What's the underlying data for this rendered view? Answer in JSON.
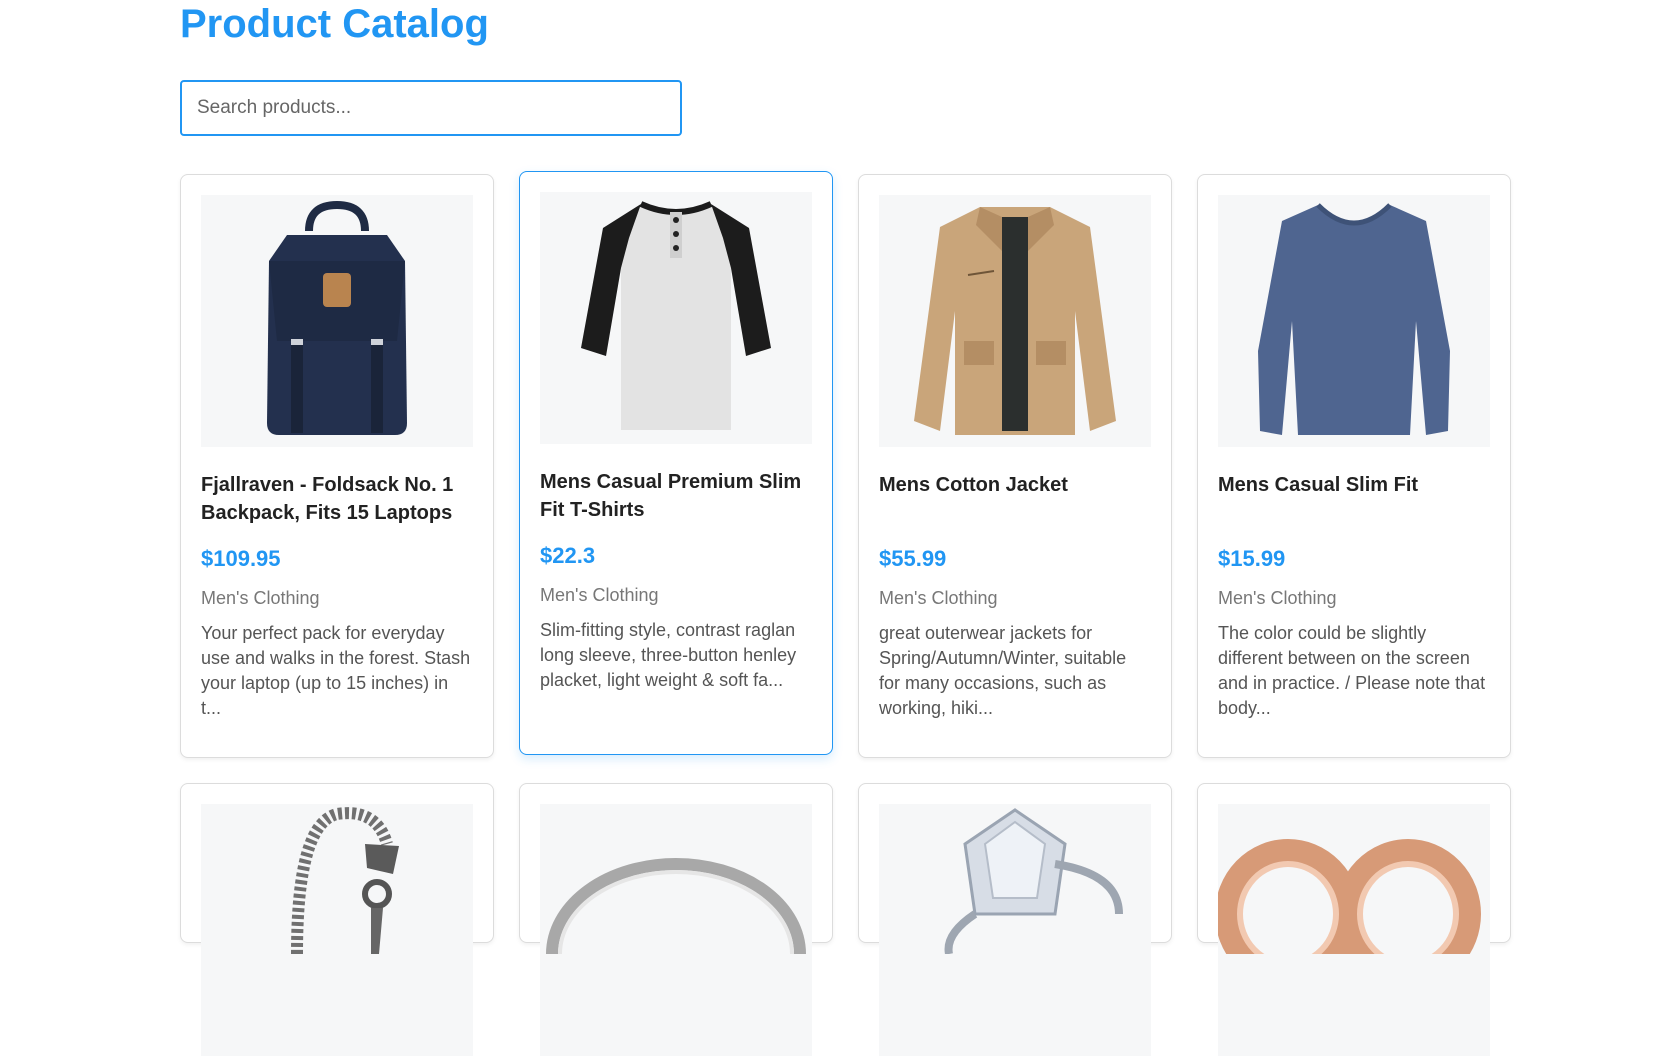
{
  "header": {
    "title": "Product Catalog"
  },
  "search": {
    "placeholder": "Search products..."
  },
  "products": [
    {
      "name": "Fjallraven - Foldsack No. 1 Backpack, Fits 15 Laptops",
      "price": "$109.95",
      "category": "Men's Clothing",
      "description": "Your perfect pack for everyday use and walks in the forest. Stash your laptop (up to 15 inches) in t...",
      "image_icon": "backpack-image"
    },
    {
      "name": "Mens Casual Premium Slim Fit T-Shirts",
      "price": "$22.3",
      "category": "Men's Clothing",
      "description": "Slim-fitting style, contrast raglan long sleeve, three-button henley placket, light weight & soft fa...",
      "image_icon": "raglan-shirt-image"
    },
    {
      "name": "Mens Cotton Jacket",
      "price": "$55.99",
      "category": "Men's Clothing",
      "description": "great outerwear jackets for Spring/Autumn/Winter, suitable for many occasions, such as working, hiki...",
      "image_icon": "jacket-image"
    },
    {
      "name": "Mens Casual Slim Fit",
      "price": "$15.99",
      "category": "Men's Clothing",
      "description": "The color could be slightly different between on the screen and in practice. / Please note that body...",
      "image_icon": "long-sleeve-shirt-image"
    }
  ],
  "products_row2": [
    {
      "image_icon": "dragon-bracelet-image"
    },
    {
      "image_icon": "silver-ring-image"
    },
    {
      "image_icon": "diamond-ring-image"
    },
    {
      "image_icon": "rose-gold-earrings-image"
    }
  ],
  "colors": {
    "accent": "#2196f3"
  }
}
